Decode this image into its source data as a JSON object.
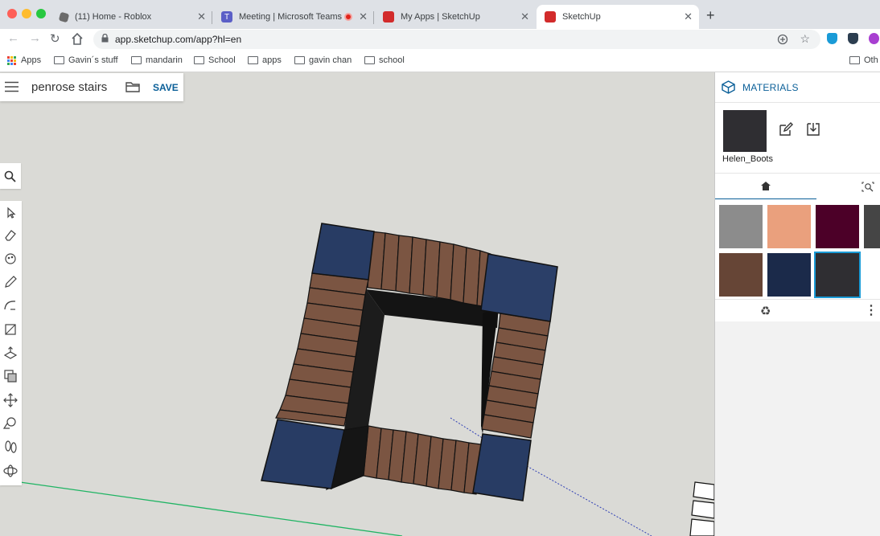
{
  "browser": {
    "tabs": [
      {
        "title": "(11) Home - Roblox"
      },
      {
        "title": "Meeting | Microsoft Teams"
      },
      {
        "title": "My Apps | SketchUp"
      },
      {
        "title": "SketchUp"
      }
    ],
    "url": "app.sketchup.com/app?hl=en",
    "bookmarks": [
      "Apps",
      "Gavin´s stuff",
      "mandarin",
      "School",
      "apps",
      "gavin chan",
      "school"
    ],
    "bookmarks_overflow": "Oth"
  },
  "app": {
    "file_name": "penrose stairs",
    "save_label": "SAVE"
  },
  "materials_panel": {
    "title": "MATERIALS",
    "selected_name": "Helen_Boots",
    "selected_color": "#2f2e32",
    "swatches": [
      {
        "color": "#8c8c8c"
      },
      {
        "color": "#eaa07d"
      },
      {
        "color": "#4c0028"
      },
      {
        "color": "#454545"
      },
      {
        "color": "#664536"
      },
      {
        "color": "#1b2a4a"
      },
      {
        "color": "#2f2e32",
        "selected": true
      }
    ]
  },
  "colors": {
    "accent": "#0a5f98",
    "stair_brown": "#7b5542",
    "block_blue": "#283c64",
    "inner_dark": "#1c1c1c"
  }
}
